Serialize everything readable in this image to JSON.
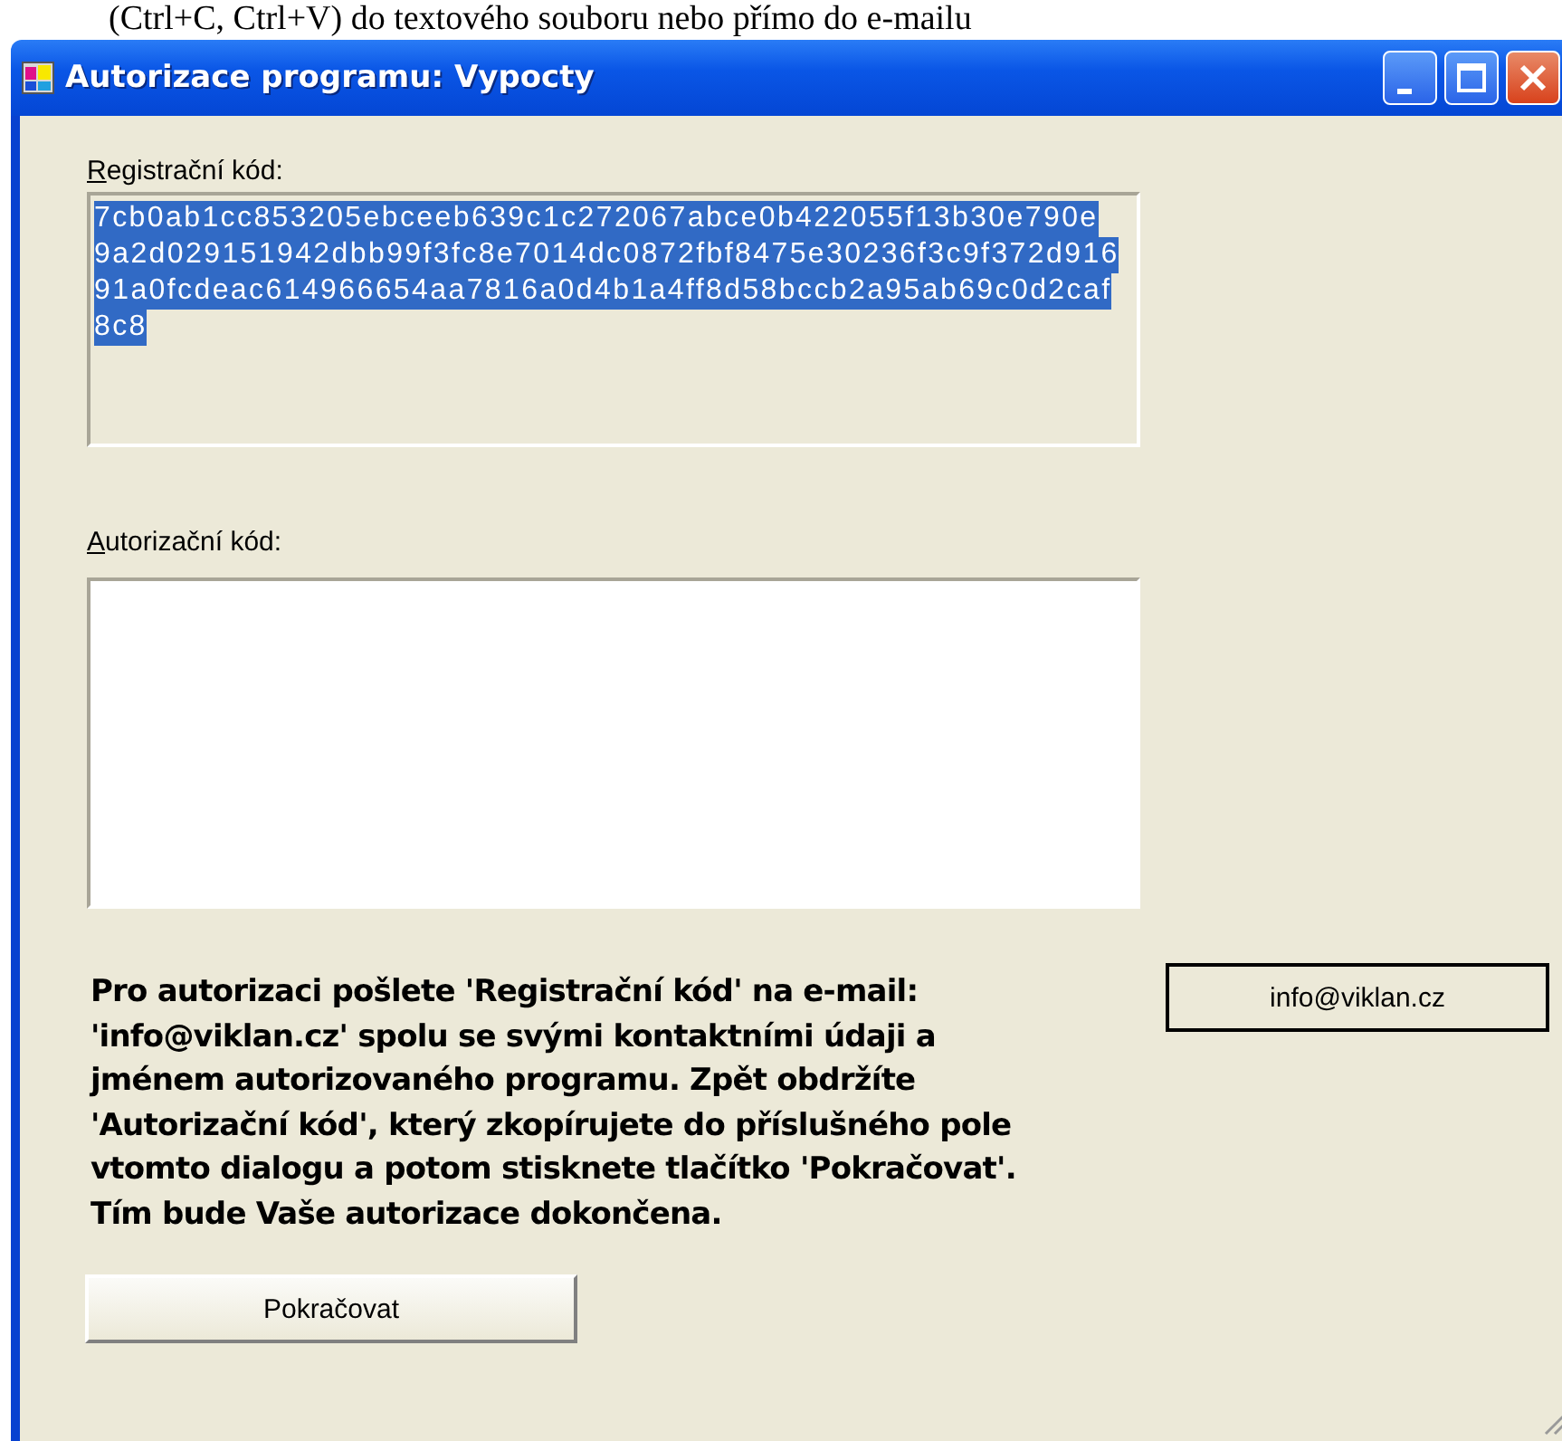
{
  "background_text": "(Ctrl+C, Ctrl+V) do textového souboru nebo přímo do e-mailu",
  "window": {
    "title": "Autorizace programu: Vypocty"
  },
  "registration": {
    "label": "Registrační kód:",
    "selected": true,
    "read_only": true,
    "lines": [
      "7cb0ab1cc853205ebceeb639c1c272067abce0b422055f13b30e790e",
      "9a2d029151942dbb99f3fc8e7014dc0872fbf8475e30236f3c9f372d916",
      "91a0fcdeac614966654aa7816a0d4b1a4ff8d58bccb2a95ab69c0d2caf",
      "8c8"
    ]
  },
  "authorization": {
    "label": "Autorizační kód:",
    "read_only": false
  },
  "instructions": [
    "Pro autorizaci pošlete 'Registrační kód' na e-mail:",
    "'info@viklan.cz' spolu se svými kontaktními údaji a",
    "jménem autorizovaného programu. Zpět obdržíte",
    "'Autorizační kód', který zkopírujete do příslušného pole",
    "vtomto dialogu a potom stisknete tlačítko 'Pokračovat'.",
    "Tím bude Vaše autorizace dokončena."
  ],
  "email_button": "info@viklan.cz",
  "continue_button": "Pokračovat"
}
